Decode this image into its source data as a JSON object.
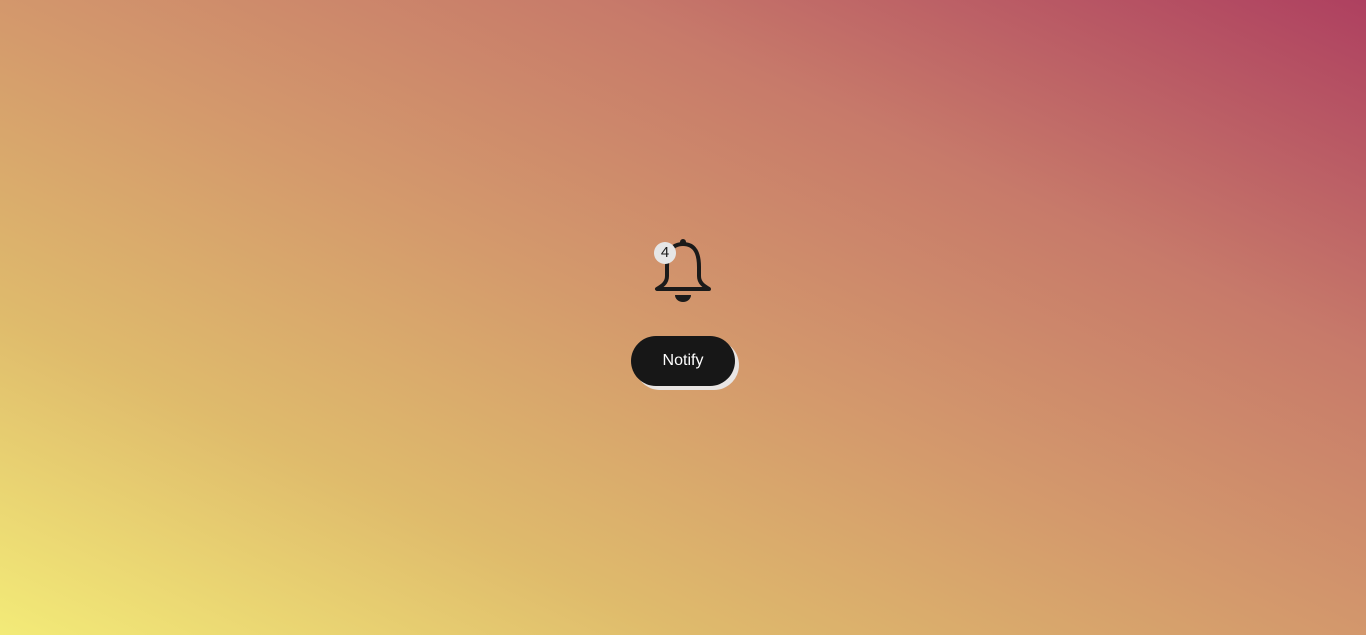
{
  "notification": {
    "icon": "bell-icon",
    "count": "4"
  },
  "actions": {
    "notify_label": "Notify"
  },
  "colors": {
    "button_bg": "#171717",
    "button_text": "#ffffff",
    "badge_bg": "#e6e6e6",
    "bell": "#1a1a1a",
    "gradient": [
      "#f3eb78",
      "#dfbb6c",
      "#d49a6c",
      "#c77a6a",
      "#ae4060"
    ]
  }
}
